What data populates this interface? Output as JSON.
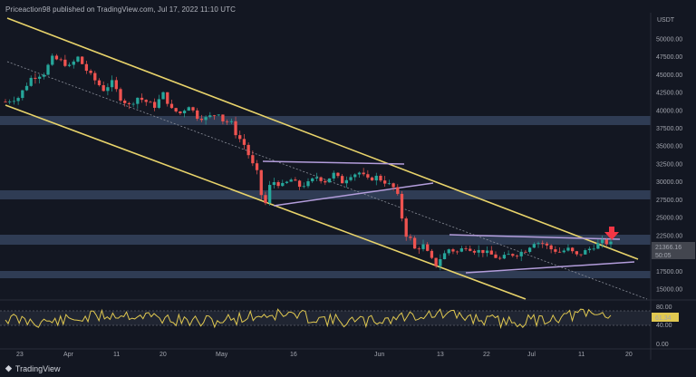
{
  "header": {
    "publisher_line": "Priceaction98 published on TradingView.com, Jul 17, 2022 11:10 UTC"
  },
  "footer": {
    "brand": "TradingView"
  },
  "chart_data": [
    {
      "type": "candlestick",
      "ylabel_currency": "USDT",
      "y_ticks": [
        "50000.00",
        "47500.00",
        "45000.00",
        "42500.00",
        "40000.00",
        "37500.00",
        "35000.00",
        "32500.00",
        "30000.00",
        "27500.00",
        "25000.00",
        "22500.00",
        "20000.00",
        "17500.00",
        "15000.00"
      ],
      "ylim": [
        14000,
        51500
      ],
      "x_ticks": [
        "23",
        "Apr",
        "11",
        "20",
        "May",
        "16",
        "Jun",
        "13",
        "22",
        "Jul",
        "11",
        "20"
      ],
      "last_price_label": "21366.16",
      "countdown_label": "50:05",
      "price_path": [
        [
          0,
          41200
        ],
        [
          3,
          41800
        ],
        [
          6,
          44500
        ],
        [
          9,
          45200
        ],
        [
          11,
          47300
        ],
        [
          13,
          46900
        ],
        [
          15,
          46100
        ],
        [
          17,
          47400
        ],
        [
          19,
          45600
        ],
        [
          21,
          44200
        ],
        [
          23,
          42900
        ],
        [
          25,
          43900
        ],
        [
          27,
          41700
        ],
        [
          29,
          40700
        ],
        [
          31,
          41800
        ],
        [
          33,
          41200
        ],
        [
          35,
          40600
        ],
        [
          37,
          42300
        ],
        [
          39,
          40100
        ],
        [
          41,
          39600
        ],
        [
          43,
          40700
        ],
        [
          45,
          39100
        ],
        [
          47,
          38900
        ],
        [
          49,
          39400
        ],
        [
          50,
          39700
        ],
        [
          51,
          38600
        ],
        [
          53,
          38200
        ],
        [
          54,
          36800
        ],
        [
          56,
          35200
        ],
        [
          58,
          32400
        ],
        [
          59,
          31300
        ],
        [
          60,
          28200
        ],
        [
          61,
          27000
        ],
        [
          62,
          29400
        ],
        [
          63,
          30000
        ],
        [
          65,
          29500
        ],
        [
          67,
          30300
        ],
        [
          69,
          29400
        ],
        [
          71,
          29800
        ],
        [
          73,
          30700
        ],
        [
          75,
          30100
        ],
        [
          77,
          31100
        ],
        [
          79,
          30000
        ],
        [
          81,
          31000
        ],
        [
          83,
          31300
        ],
        [
          85,
          30300
        ],
        [
          87,
          30700
        ],
        [
          89,
          30000
        ],
        [
          91,
          29200
        ],
        [
          92,
          28000
        ],
        [
          93,
          25000
        ],
        [
          94,
          22600
        ],
        [
          95,
          22000
        ],
        [
          96,
          20600
        ],
        [
          98,
          21100
        ],
        [
          100,
          19100
        ],
        [
          101,
          18400
        ],
        [
          102,
          19300
        ],
        [
          104,
          20600
        ],
        [
          106,
          20200
        ],
        [
          108,
          21000
        ],
        [
          110,
          20400
        ],
        [
          112,
          20300
        ],
        [
          114,
          19800
        ],
        [
          116,
          19200
        ],
        [
          118,
          19800
        ],
        [
          120,
          19900
        ],
        [
          122,
          20500
        ],
        [
          124,
          21600
        ],
        [
          126,
          21400
        ],
        [
          128,
          20600
        ],
        [
          130,
          20200
        ],
        [
          132,
          20600
        ],
        [
          134,
          19700
        ],
        [
          136,
          20300
        ],
        [
          138,
          21000
        ],
        [
          140,
          21600
        ],
        [
          142,
          21366
        ]
      ]
    },
    {
      "type": "oscillator",
      "y_ticks": [
        "80.00",
        "40.00",
        "0.00"
      ],
      "level_label": "61.34"
    }
  ]
}
